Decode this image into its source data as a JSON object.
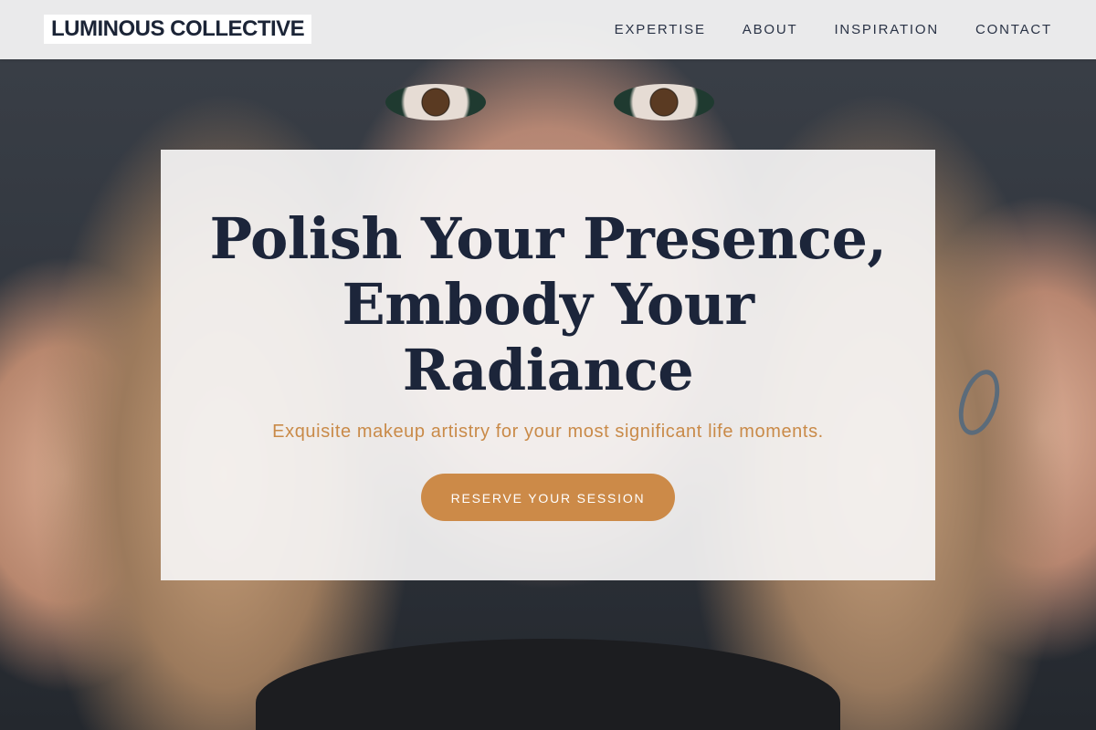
{
  "brand": {
    "logo_text": "LUMINOUS COLLECTIVE"
  },
  "nav": {
    "items": [
      {
        "label": "EXPERTISE"
      },
      {
        "label": "ABOUT"
      },
      {
        "label": "INSPIRATION"
      },
      {
        "label": "CONTACT"
      }
    ]
  },
  "hero": {
    "title": "Polish Your Presence, Embody Your Radiance",
    "subtitle": "Exquisite makeup artistry for your most significant life moments.",
    "cta_label": "RESERVE YOUR SESSION"
  },
  "colors": {
    "heading": "#1c253a",
    "accent": "#cc8a48",
    "header_bg": "#f8f8f8",
    "card_bg": "#f6f5f5"
  }
}
